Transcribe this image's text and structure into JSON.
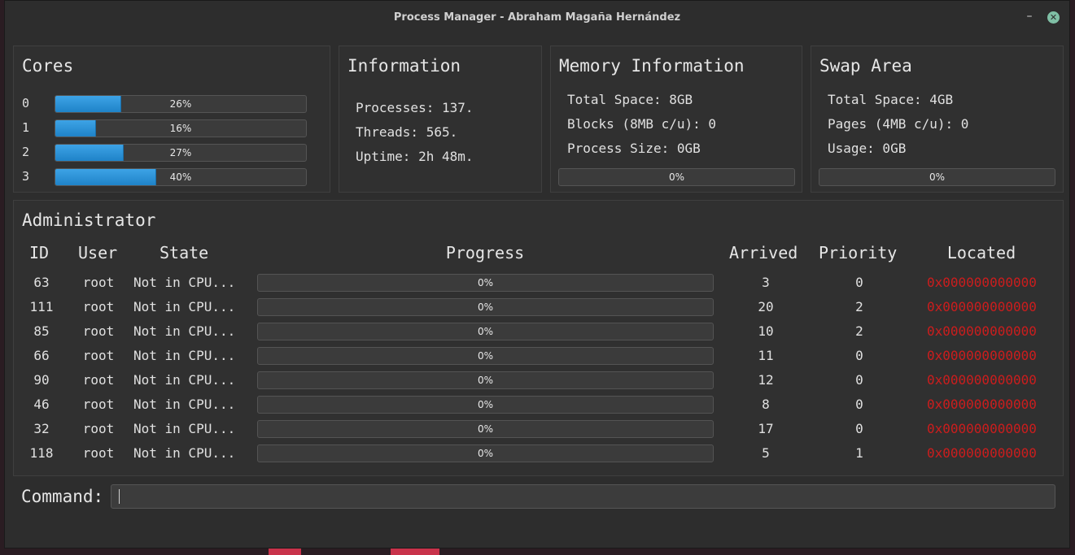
{
  "window": {
    "title": "Process Manager - Abraham Magaña Hernández",
    "minimize_glyph": "–",
    "close_glyph": "✕"
  },
  "cores": {
    "title": "Cores",
    "items": [
      {
        "label": "0",
        "text": "26%",
        "value": 0.26
      },
      {
        "label": "1",
        "text": "16%",
        "value": 0.16
      },
      {
        "label": "2",
        "text": "27%",
        "value": 0.27
      },
      {
        "label": "3",
        "text": "40%",
        "value": 0.4
      }
    ]
  },
  "information": {
    "title": "Information",
    "processes": "Processes: 137.",
    "threads": "Threads: 565.",
    "uptime": "Uptime: 2h 48m."
  },
  "memory": {
    "title": "Memory Information",
    "total": "Total Space: 8GB",
    "blocks": "Blocks (8MB c/u): 0",
    "process_size": "Process Size: 0GB",
    "bar_text": "0%",
    "bar_value": 0
  },
  "swap": {
    "title": "Swap Area",
    "total": "Total Space: 4GB",
    "pages": "Pages (4MB c/u): 0",
    "usage": "Usage: 0GB",
    "bar_text": "0%",
    "bar_value": 0
  },
  "admin": {
    "title": "Administrator",
    "headers": {
      "id": "ID",
      "user": "User",
      "state": "State",
      "progress": "Progress",
      "arrived": "Arrived",
      "priority": "Priority",
      "located": "Located"
    },
    "rows": [
      {
        "id": "63",
        "user": "root",
        "state": "Not in CPU...",
        "progress": "0%",
        "arrived": "3",
        "priority": "0",
        "located": "0x000000000000"
      },
      {
        "id": "111",
        "user": "root",
        "state": "Not in CPU...",
        "progress": "0%",
        "arrived": "20",
        "priority": "2",
        "located": "0x000000000000"
      },
      {
        "id": "85",
        "user": "root",
        "state": "Not in CPU...",
        "progress": "0%",
        "arrived": "10",
        "priority": "2",
        "located": "0x000000000000"
      },
      {
        "id": "66",
        "user": "root",
        "state": "Not in CPU...",
        "progress": "0%",
        "arrived": "11",
        "priority": "0",
        "located": "0x000000000000"
      },
      {
        "id": "90",
        "user": "root",
        "state": "Not in CPU...",
        "progress": "0%",
        "arrived": "12",
        "priority": "0",
        "located": "0x000000000000"
      },
      {
        "id": "46",
        "user": "root",
        "state": "Not in CPU...",
        "progress": "0%",
        "arrived": "8",
        "priority": "0",
        "located": "0x000000000000"
      },
      {
        "id": "32",
        "user": "root",
        "state": "Not in CPU...",
        "progress": "0%",
        "arrived": "17",
        "priority": "0",
        "located": "0x000000000000"
      },
      {
        "id": "118",
        "user": "root",
        "state": "Not in CPU...",
        "progress": "0%",
        "arrived": "5",
        "priority": "1",
        "located": "0x000000000000"
      }
    ]
  },
  "command": {
    "label": "Command:",
    "value": ""
  },
  "colors": {
    "bar_fill": "#2d96dc",
    "located_text": "#cc1d1d",
    "close_button": "#7fbfa5"
  }
}
